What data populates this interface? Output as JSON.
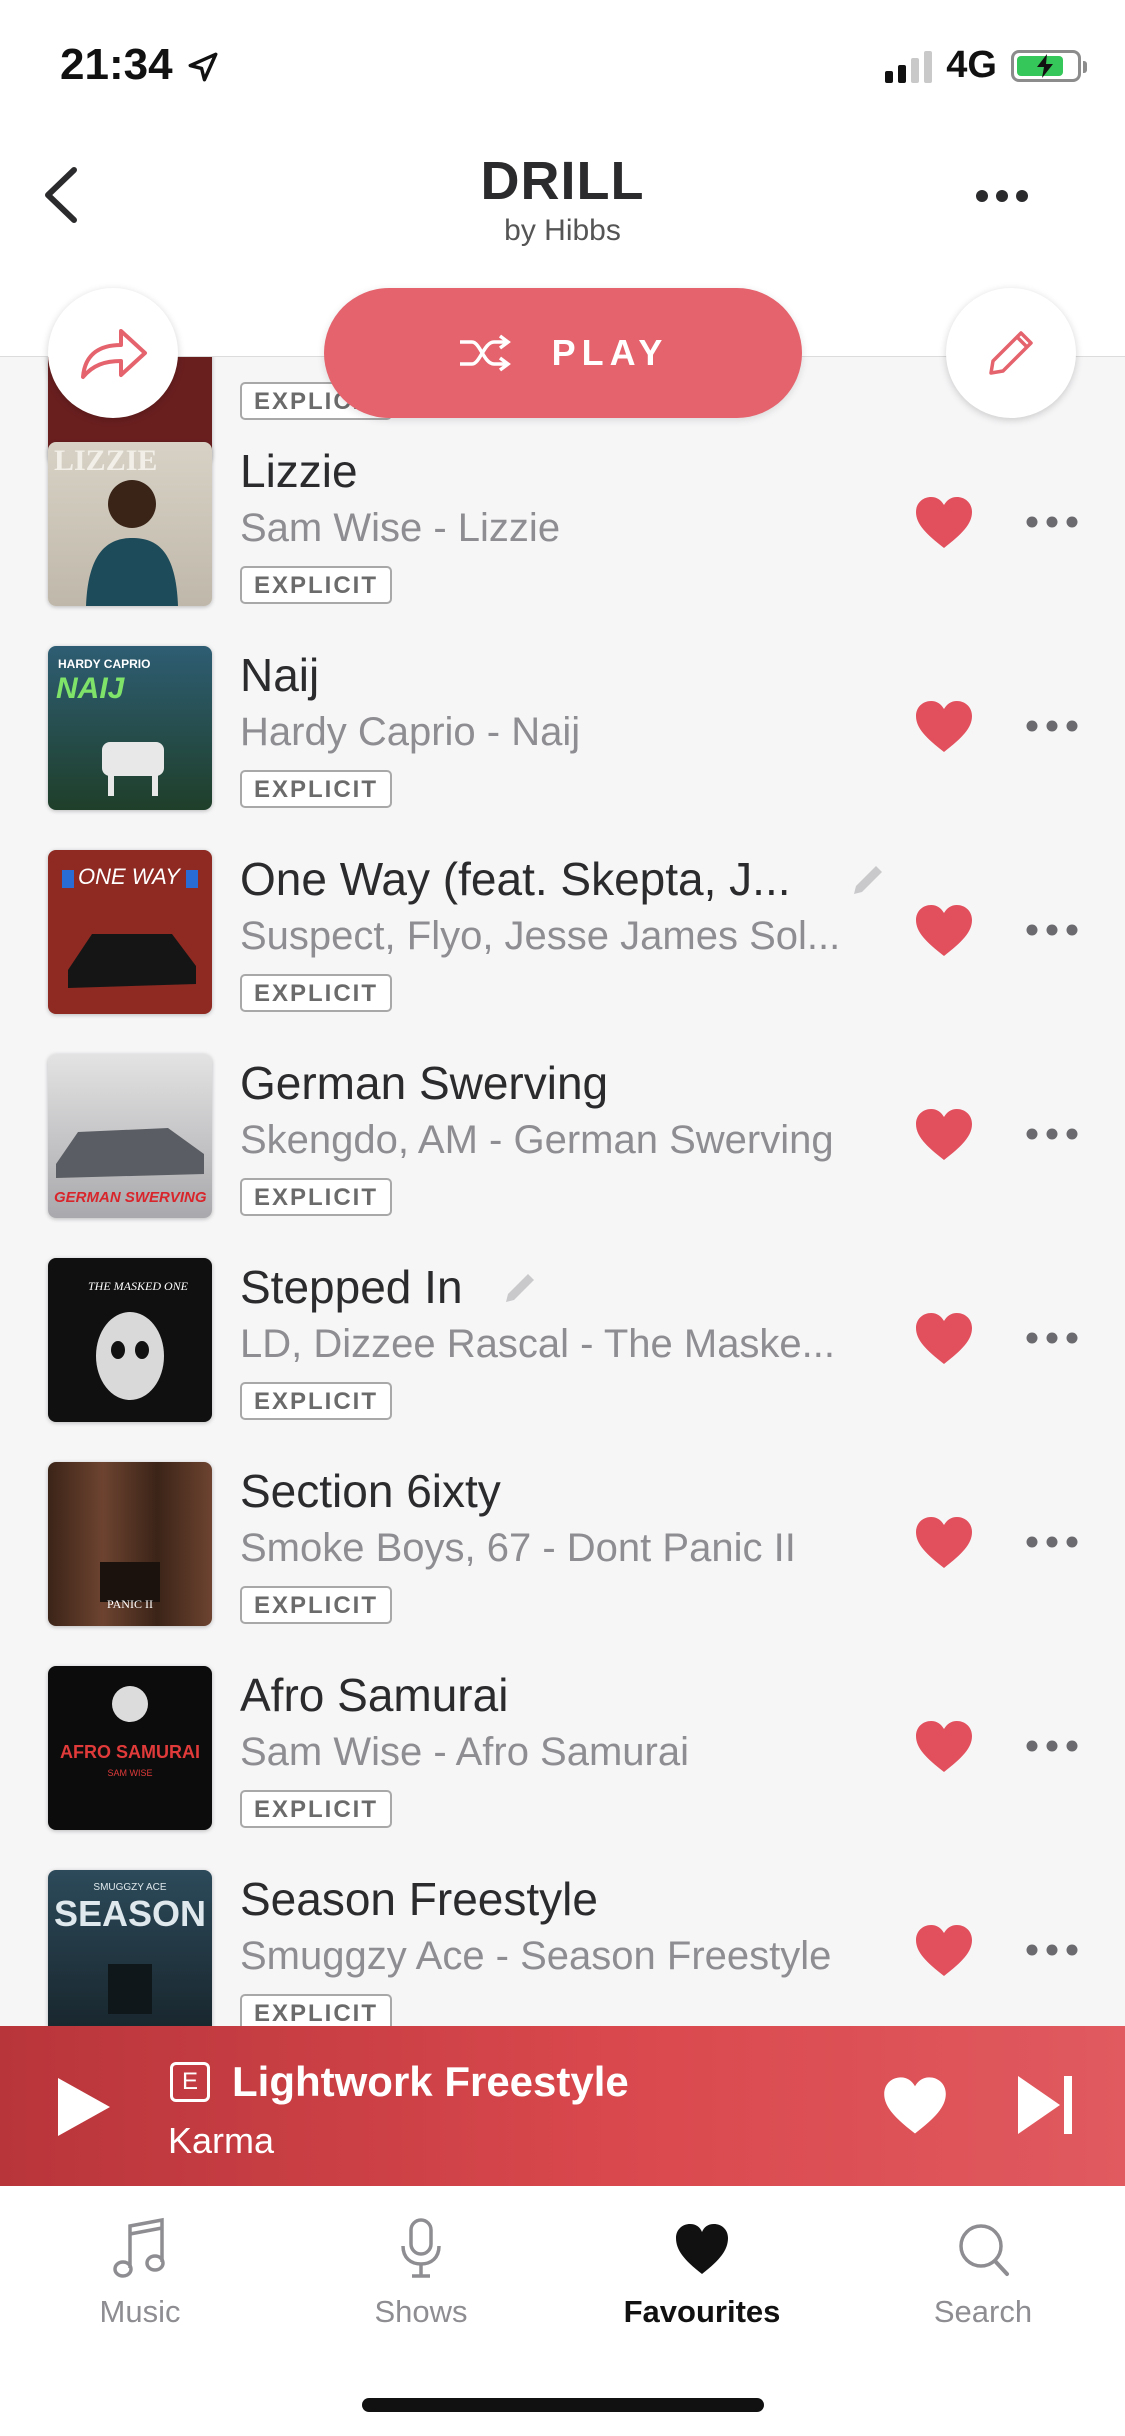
{
  "status": {
    "time": "21:34",
    "network": "4G"
  },
  "header": {
    "title": "DRILL",
    "subtitle": "by Hibbs"
  },
  "play_button": {
    "label": "PLAY"
  },
  "colors": {
    "accent": "#e4636d",
    "heart": "#e2505d",
    "player_start": "#b8353a",
    "player_end": "#e05a5f"
  },
  "tracks": [
    {
      "title": "",
      "subtitle": "",
      "explicit": "EXPLICIT"
    },
    {
      "title": "Lizzie",
      "subtitle": "Sam Wise - Lizzie",
      "explicit": "EXPLICIT"
    },
    {
      "title": "Naij",
      "subtitle": "Hardy Caprio - Naij",
      "explicit": "EXPLICIT"
    },
    {
      "title": "One Way (feat. Skepta, J...",
      "subtitle": "Suspect, Flyo, Jesse James Sol...",
      "explicit": "EXPLICIT",
      "edited": true
    },
    {
      "title": "German Swerving",
      "subtitle": "Skengdo, AM - German Swerving",
      "explicit": "EXPLICIT"
    },
    {
      "title": "Stepped In",
      "subtitle": "LD, Dizzee Rascal - The Maske...",
      "explicit": "EXPLICIT",
      "edited": true
    },
    {
      "title": "Section 6ixty",
      "subtitle": "Smoke Boys, 67 - Dont Panic II",
      "explicit": "EXPLICIT"
    },
    {
      "title": "Afro Samurai",
      "subtitle": "Sam Wise - Afro Samurai",
      "explicit": "EXPLICIT"
    },
    {
      "title": "Season Freestyle",
      "subtitle": "Smuggzy Ace - Season Freestyle",
      "explicit": "EXPLICIT"
    }
  ],
  "art_text": {
    "lizzie": "LIZZIE",
    "naij": "NAIJ",
    "naij_top": "HARDY CAPRIO",
    "one_way": "ONE WAY",
    "german": "GERMAN SWERVING",
    "masked": "THE MASKED ONE",
    "panic": "PANIC II",
    "afro": "AFRO SAMURAI",
    "afro_sub": "SAM WISE",
    "season": "SEASON",
    "season_top": "SMUGGZY ACE"
  },
  "now_playing": {
    "badge": "E",
    "title": "Lightwork Freestyle",
    "artist": "Karma"
  },
  "tabs": [
    {
      "label": "Music",
      "icon": "music-note-icon"
    },
    {
      "label": "Shows",
      "icon": "microphone-icon"
    },
    {
      "label": "Favourites",
      "icon": "heart-icon",
      "active": true
    },
    {
      "label": "Search",
      "icon": "search-icon"
    }
  ]
}
